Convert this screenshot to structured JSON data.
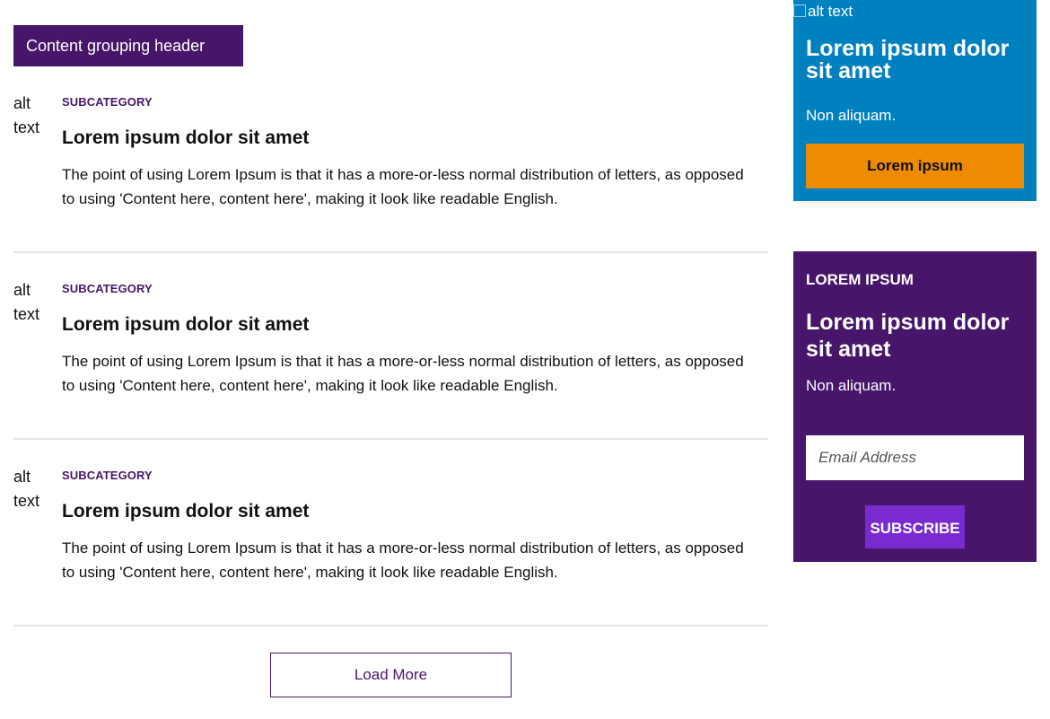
{
  "main": {
    "group_header": "Content grouping header",
    "articles": [
      {
        "image_alt": "alt text",
        "subcategory": "SUBCATEGORY",
        "title": "Lorem ipsum dolor sit amet",
        "body": "The point of using Lorem Ipsum is that it has a more-or-less normal distribution of letters, as opposed to using 'Content here, content here', making it look like readable English."
      },
      {
        "image_alt": "alt text",
        "subcategory": "SUBCATEGORY",
        "title": "Lorem ipsum dolor sit amet",
        "body": "The point of using Lorem Ipsum is that it has a more-or-less normal distribution of letters, as opposed to using 'Content here, content here', making it look like readable English."
      },
      {
        "image_alt": "alt text",
        "subcategory": "SUBCATEGORY",
        "title": "Lorem ipsum dolor sit amet",
        "body": "The point of using Lorem Ipsum is that it has a more-or-less normal distribution of letters, as opposed to using 'Content here, content here', making it look like readable English."
      }
    ],
    "load_more_label": "Load More"
  },
  "sidebar": {
    "promo": {
      "image_alt": "alt text",
      "title": "Lorem ipsum dolor sit amet",
      "subtitle": "Non aliquam.",
      "button_label": "Lorem ipsum"
    },
    "newsletter": {
      "eyebrow": "LOREM IPSUM",
      "title": "Lorem ipsum dolor sit amet",
      "subtitle": "Non aliquam.",
      "email_placeholder": "Email Address",
      "email_value": "",
      "subscribe_label": "SUBSCRIBE"
    }
  },
  "colors": {
    "brand_purple": "#47166a",
    "promo_blue": "#0081bf",
    "promo_orange": "#ef8b00",
    "subscribe_violet": "#7a2bd0",
    "divider": "#e6e6e6"
  },
  "icons": {
    "broken_image": "broken-image-icon"
  }
}
